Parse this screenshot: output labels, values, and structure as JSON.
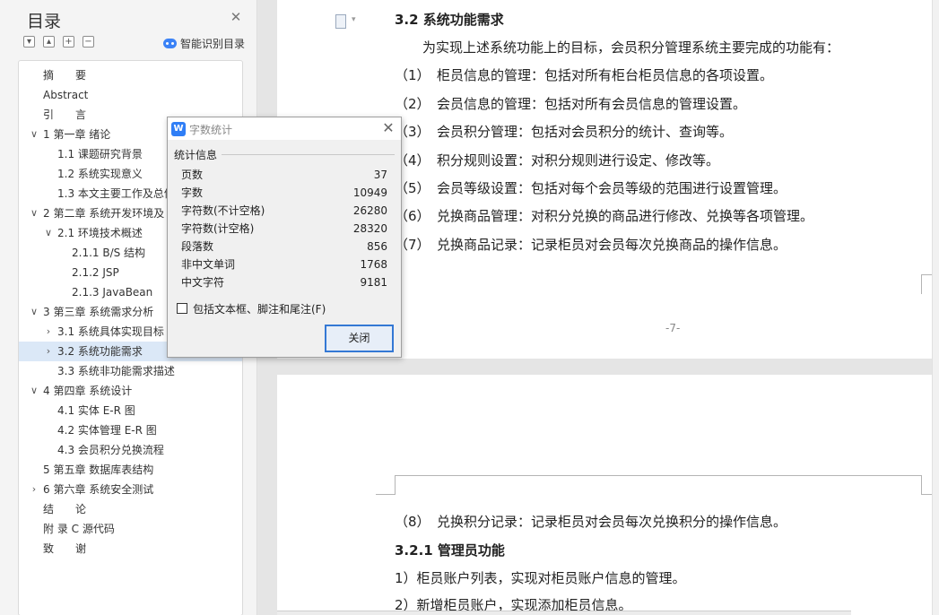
{
  "sidebar": {
    "title": "目录",
    "smart_label": "智能识别目录",
    "tools": [
      "−",
      "+",
      "+",
      "−"
    ],
    "items": [
      {
        "label": "摘　　要",
        "arrow": "",
        "indent": 0
      },
      {
        "label": "Abstract",
        "arrow": "",
        "indent": 0
      },
      {
        "label": "引　　言",
        "arrow": "",
        "indent": 0
      },
      {
        "label": "1 第一章 绪论",
        "arrow": "∨",
        "indent": 0
      },
      {
        "label": "1.1 课题研究背景",
        "arrow": "",
        "indent": 1
      },
      {
        "label": "1.2 系统实现意义",
        "arrow": "",
        "indent": 1
      },
      {
        "label": "1.3 本文主要工作及总体",
        "arrow": "",
        "indent": 1
      },
      {
        "label": "2 第二章 系统开发环境及",
        "arrow": "∨",
        "indent": 0
      },
      {
        "label": "2.1 环境技术概述",
        "arrow": "∨",
        "indent": 1
      },
      {
        "label": "2.1.1 B/S 结构",
        "arrow": "",
        "indent": 2
      },
      {
        "label": "2.1.2 JSP",
        "arrow": "",
        "indent": 2
      },
      {
        "label": "2.1.3 JavaBean",
        "arrow": "",
        "indent": 2
      },
      {
        "label": "3 第三章 系统需求分析",
        "arrow": "∨",
        "indent": 0
      },
      {
        "label": "3.1 系统具体实现目标",
        "arrow": "›",
        "indent": 1
      },
      {
        "label": "3.2 系统功能需求",
        "arrow": "›",
        "indent": 1,
        "selected": true
      },
      {
        "label": "3.3 系统非功能需求描述",
        "arrow": "",
        "indent": 1
      },
      {
        "label": "4 第四章 系统设计",
        "arrow": "∨",
        "indent": 0
      },
      {
        "label": "4.1 实体 E-R 图",
        "arrow": "",
        "indent": 1
      },
      {
        "label": "4.2 实体管理 E-R 图",
        "arrow": "",
        "indent": 1
      },
      {
        "label": "4.3 会员积分兑换流程",
        "arrow": "",
        "indent": 1
      },
      {
        "label": "5 第五章 数据库表结构",
        "arrow": "",
        "indent": 0
      },
      {
        "label": "6 第六章 系统安全测试",
        "arrow": "›",
        "indent": 0
      },
      {
        "label": "结　　论",
        "arrow": "",
        "indent": 0
      },
      {
        "label": "附 录 C 源代码",
        "arrow": "",
        "indent": 0
      },
      {
        "label": "致　　谢",
        "arrow": "",
        "indent": 0
      }
    ]
  },
  "document": {
    "page1": {
      "heading": "3.2 系统功能需求",
      "intro": "为实现上述系统功能上的目标，会员积分管理系统主要完成的功能有：",
      "items": [
        "（1）　柜员信息的管理：包括对所有柜台柜员信息的各项设置。",
        "（2）　会员信息的管理：包括对所有会员信息的管理设置。",
        "（3）　会员积分管理：包括对会员积分的统计、查询等。",
        "（4）　积分规则设置：对积分规则进行设定、修改等。",
        "（5）　会员等级设置：包括对每个会员等级的范围进行设置管理。",
        "（6）　兑换商品管理：对积分兑换的商品进行修改、兑换等各项管理。",
        "（7）　兑换商品记录：记录柜员对会员每次兑换商品的操作信息。"
      ],
      "page_number": "-7-"
    },
    "page2": {
      "item8": "（8）　兑换积分记录：记录柜员对会员每次兑换积分的操作信息。",
      "subheading": "3.2.1 管理员功能",
      "lines": [
        "1）柜员账户列表，实现对柜员账户信息的管理。",
        "2）新增柜员账户，实现添加柜员信息。"
      ]
    }
  },
  "dialog": {
    "app_icon": "W",
    "title": "字数统计",
    "group_label": "统计信息",
    "stats": [
      {
        "name": "页数",
        "value": "37"
      },
      {
        "name": "字数",
        "value": "10949"
      },
      {
        "name": "字符数(不计空格)",
        "value": "26280"
      },
      {
        "name": "字符数(计空格)",
        "value": "28320"
      },
      {
        "name": "段落数",
        "value": "856"
      },
      {
        "name": "非中文单词",
        "value": "1768"
      },
      {
        "name": "中文字符",
        "value": "9181"
      }
    ],
    "checkbox_label": "包括文本框、脚注和尾注(F)",
    "close_button": "关闭"
  },
  "colors": {
    "accent": "#3478d4",
    "selected_bg": "#dbe8f7",
    "app_icon": "#2f7ef6"
  }
}
